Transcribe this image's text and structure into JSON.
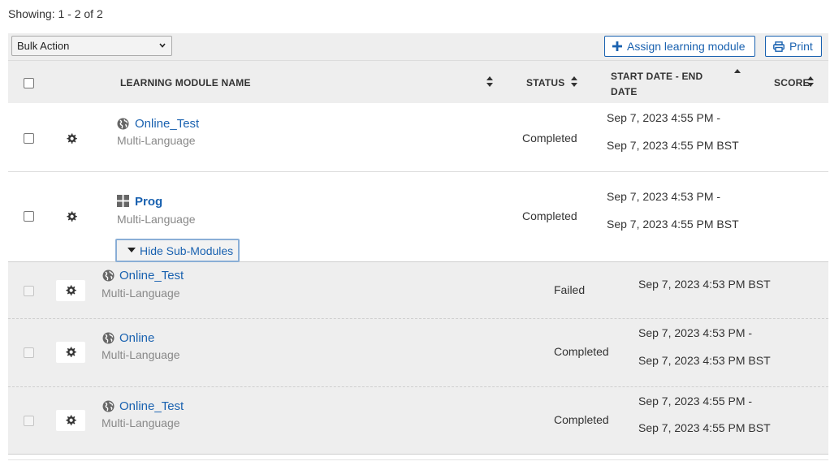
{
  "showing": "Showing: 1 - 2 of 2",
  "toolbar": {
    "bulk_action": "Bulk Action",
    "assign_label": "Assign learning module",
    "print_label": "Print"
  },
  "header": {
    "name": "LEARNING MODULE NAME",
    "status": "STATUS",
    "date_line1": "START DATE - END",
    "date_line2": "DATE",
    "score": "SCORE"
  },
  "rows": [
    {
      "icon": "globe-icon",
      "name": "Online_Test",
      "language": "Multi-Language",
      "status": "Completed",
      "date_start": "Sep 7, 2023 4:55 PM -",
      "date_end": "Sep 7, 2023 4:55 PM BST"
    },
    {
      "icon": "program-grid-icon",
      "name": "Prog",
      "language": "Multi-Language",
      "status": "Completed",
      "date_start": "Sep 7, 2023 4:53 PM -",
      "date_end": "Sep 7, 2023 4:55 PM BST",
      "toggle_label": "Hide Sub-Modules"
    }
  ],
  "sub_modules": [
    {
      "icon": "globe-icon",
      "name": "Online_Test",
      "language": "Multi-Language",
      "status": "Failed",
      "date": "Sep 7, 2023 4:53 PM BST"
    },
    {
      "icon": "globe-icon",
      "name": "Online",
      "language": "Multi-Language",
      "status": "Completed",
      "date_start": "Sep 7, 2023 4:53 PM -",
      "date_end": "Sep 7, 2023 4:53 PM BST"
    },
    {
      "icon": "globe-icon",
      "name": "Online_Test",
      "language": "Multi-Language",
      "status": "Completed",
      "date_start": "Sep 7, 2023 4:55 PM -",
      "date_end": "Sep 7, 2023 4:55 PM BST"
    }
  ],
  "colors": {
    "link": "#1a62b0",
    "header_bg": "#eeeeee",
    "sub_bg": "#eeeeee"
  }
}
